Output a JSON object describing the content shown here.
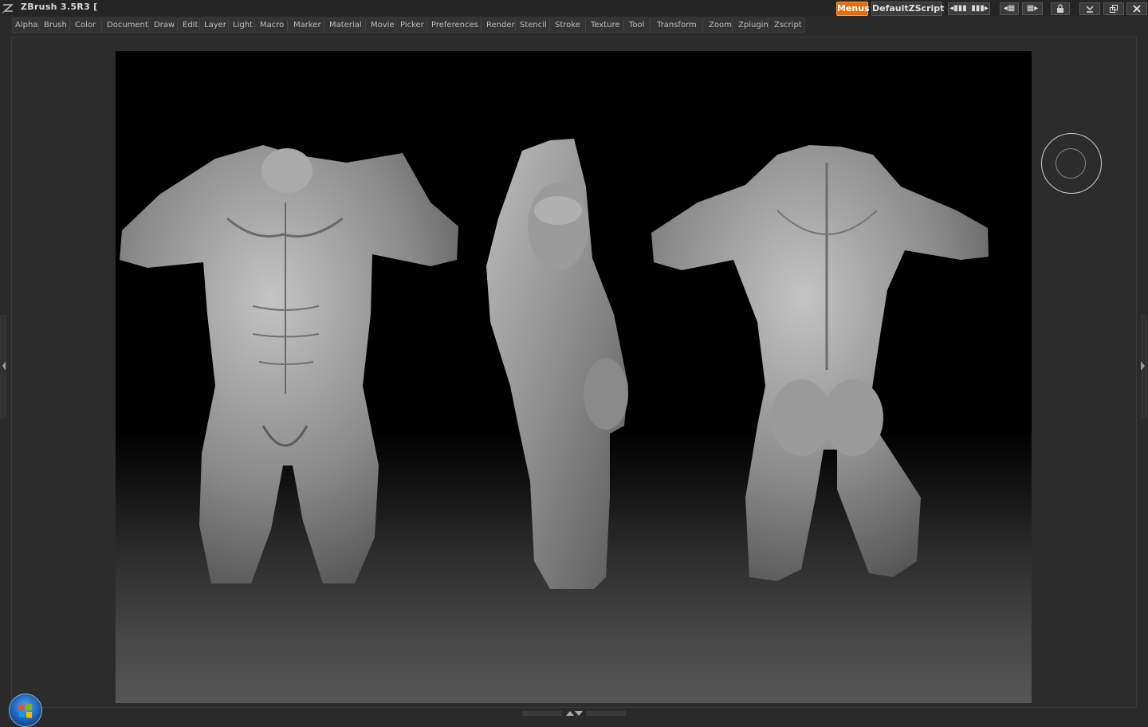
{
  "app": {
    "title": "ZBrush 3.5R3  ["
  },
  "toolbar": {
    "menus_label": "Menus",
    "zscript_label": "DefaultZScript",
    "accent": "#e06d10"
  },
  "menubar": {
    "items": [
      "Alpha",
      "Brush",
      "Color",
      "Document",
      "Draw",
      "Edit",
      "Layer",
      "Light",
      "Macro",
      "Marker",
      "Material",
      "Movie",
      "Picker",
      "Preferences",
      "Render",
      "Stencil",
      "Stroke",
      "Texture",
      "Tool",
      "Transform",
      "Zoom",
      "Zplugin",
      "Zscript"
    ]
  },
  "canvas": {
    "content": "sculpted-male-torso-views",
    "views": [
      "front",
      "side",
      "back"
    ]
  },
  "icons": [
    "zbrush-logo-icon",
    "scroll-left-icon",
    "scroll-right-icon",
    "layout-icon",
    "lock-icon",
    "minimize-icon",
    "restore-icon",
    "close-icon",
    "collapse-left-icon",
    "collapse-right-icon",
    "tray-toggle-icon",
    "windows-start-icon"
  ]
}
